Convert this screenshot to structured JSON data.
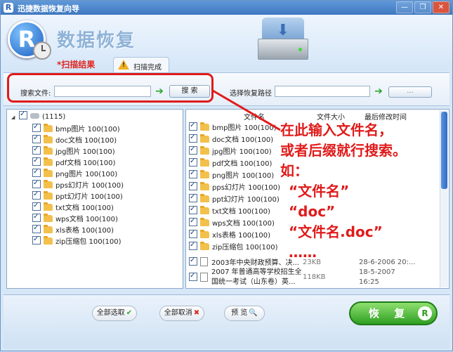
{
  "window": {
    "title": "迅捷数据恢复向导",
    "min_glyph": "—",
    "restore_glyph": "❐",
    "close_glyph": "✕"
  },
  "header": {
    "logo_letter": "R",
    "title": "数据恢复",
    "drive_arrow_glyph": "⬇"
  },
  "tabs": {
    "scan_result": "*扫描结果",
    "scan_done": "扫描完成",
    "warning_glyph": "!"
  },
  "search": {
    "file_label": "搜索文件:",
    "file_value": "",
    "go_glyph": "➔",
    "search_button": "搜 索",
    "path_label": "选择恢复路径",
    "path_value": "",
    "browse_button": "..."
  },
  "left_tree": {
    "root_label": "(1115)",
    "items": [
      "bmp图片 100(100)",
      "doc文档 100(100)",
      "jpg图片 100(100)",
      "pdf文档 100(100)",
      "png图片 100(100)",
      "pps幻灯片 100(100)",
      "ppt幻灯片 100(100)",
      "txt文档 100(100)",
      "wps文档 100(100)",
      "xls表格 100(100)",
      "zip压缩包 100(100)"
    ]
  },
  "right_list": {
    "headers": [
      "文件名",
      "文件大小",
      "最后修改时间"
    ],
    "folders": [
      "bmp图片 100(100)",
      "doc文档 100(100)",
      "jpg图片 100(100)",
      "pdf文档 100(100)",
      "png图片 100(100)",
      "pps幻灯片 100(100)",
      "ppt幻灯片 100(100)",
      "txt文档 100(100)",
      "wps文档 100(100)",
      "xls表格 100(100)",
      "zip压缩包 100(100)"
    ],
    "files": [
      {
        "name": "2003年中央财政预算、决...",
        "name2": "",
        "size": "23KB",
        "date": "28-6-2006 20:..."
      },
      {
        "name": "2007 年普通高等学校招生全",
        "name2": "国统一考试（山东卷）英...",
        "size": "118KB",
        "date": "18-5-2007",
        "date2": "16:25"
      }
    ]
  },
  "annotation": {
    "line1": "在此输入文件名，",
    "line2": "或者后缀就行搜索。",
    "line3": "如：",
    "line4": "“文件名”",
    "line5": "“doc”",
    "line6": "“文件名.doc”",
    "line7": "……"
  },
  "bottom": {
    "select_all": "全部选取",
    "deselect_all": "全部取消",
    "preview": "预 览",
    "recover": "恢 复",
    "recover_logo": "R",
    "check_glyph": "✔",
    "x_glyph": "✖",
    "search_glyph": "🔍"
  }
}
